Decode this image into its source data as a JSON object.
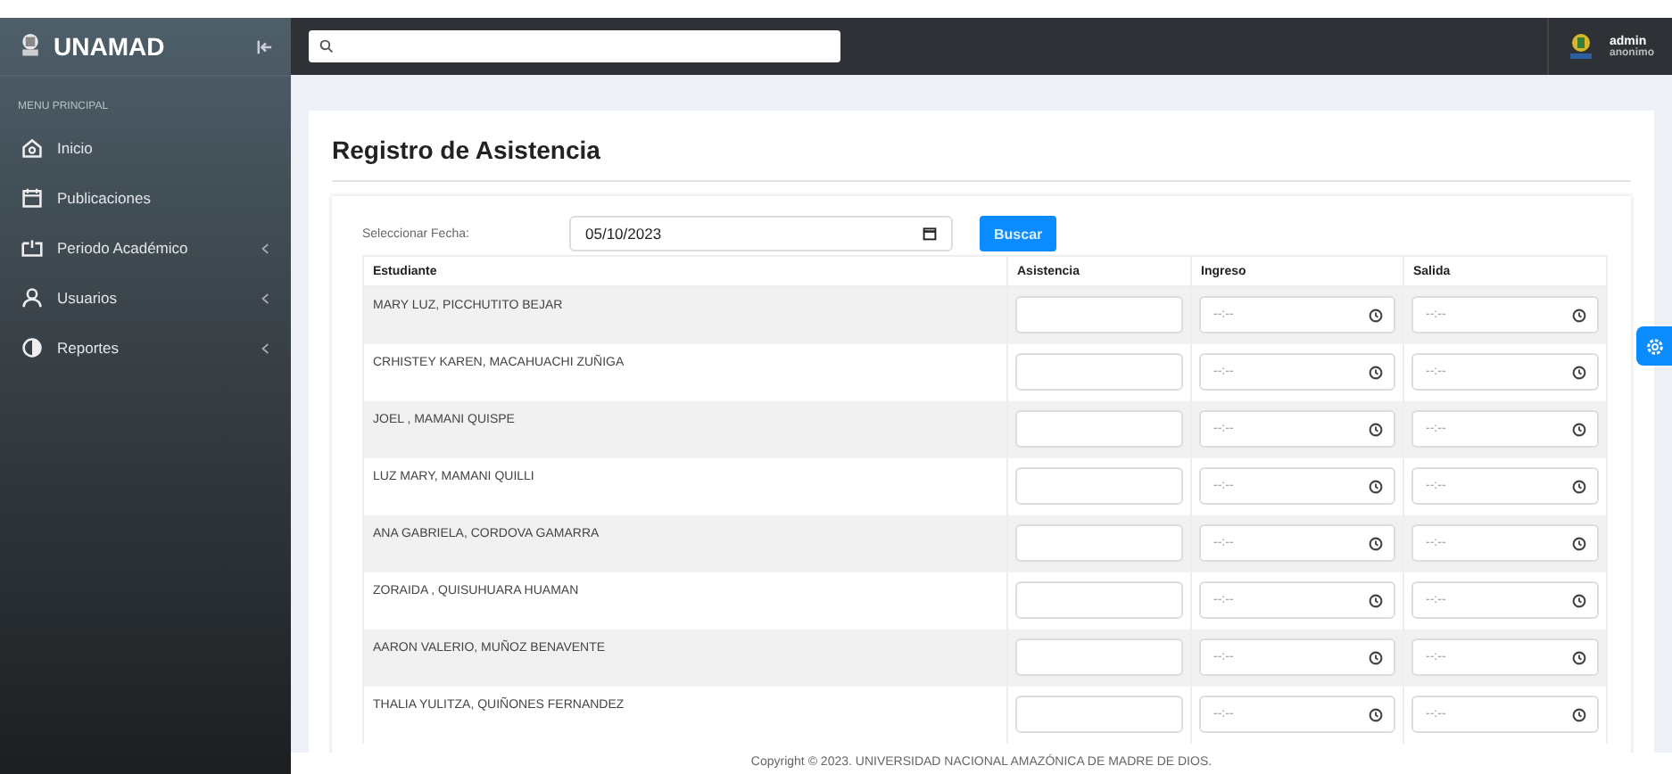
{
  "sidebar": {
    "brand": "UNAMAD",
    "section_label": "MENU PRINCIPAL",
    "items": [
      {
        "label": "Inicio",
        "kind": "home",
        "has_submenu": false
      },
      {
        "label": "Publicaciones",
        "kind": "calendar",
        "has_submenu": false
      },
      {
        "label": "Periodo Académico",
        "kind": "folder",
        "has_submenu": true
      },
      {
        "label": "Usuarios",
        "kind": "user",
        "has_submenu": true
      },
      {
        "label": "Reportes",
        "kind": "contrast",
        "has_submenu": true
      }
    ]
  },
  "header": {
    "user": {
      "name": "admin",
      "role": "anonimo"
    }
  },
  "page_title": "Registro de Asistencia",
  "filter": {
    "label": "Seleccionar Fecha:",
    "date_value": "05/10/2023",
    "button": "Buscar"
  },
  "table": {
    "columns": [
      "Estudiante",
      "Asistencia",
      "Ingreso",
      "Salida"
    ],
    "rows": [
      {
        "student": "MARY LUZ, PICCHUTITO BEJAR",
        "ingreso_placeholder": "--:--",
        "salida_placeholder": "--:--"
      },
      {
        "student": "CRHISTEY KAREN, MACAHUACHI ZUÑIGA",
        "ingreso_placeholder": "--:--",
        "salida_placeholder": "--:--"
      },
      {
        "student": "JOEL , MAMANI QUISPE",
        "ingreso_placeholder": "--:--",
        "salida_placeholder": "--:--"
      },
      {
        "student": "LUZ MARY, MAMANI QUILLI",
        "ingreso_placeholder": "--:--",
        "salida_placeholder": "--:--"
      },
      {
        "student": "ANA GABRIELA, CORDOVA GAMARRA",
        "ingreso_placeholder": "--:--",
        "salida_placeholder": "--:--"
      },
      {
        "student": "ZORAIDA , QUISUHUARA HUAMAN",
        "ingreso_placeholder": "--:--",
        "salida_placeholder": "--:--"
      },
      {
        "student": "AARON VALERIO, MUÑOZ BENAVENTE",
        "ingreso_placeholder": "--:--",
        "salida_placeholder": "--:--"
      },
      {
        "student": "THALIA YULITZA, QUIÑONES FERNANDEZ",
        "ingreso_placeholder": "--:--",
        "salida_placeholder": "--:--"
      }
    ]
  },
  "footer": "Copyright © 2023. UNIVERSIDAD NACIONAL AMAZÓNICA DE MADRE DE DIOS."
}
